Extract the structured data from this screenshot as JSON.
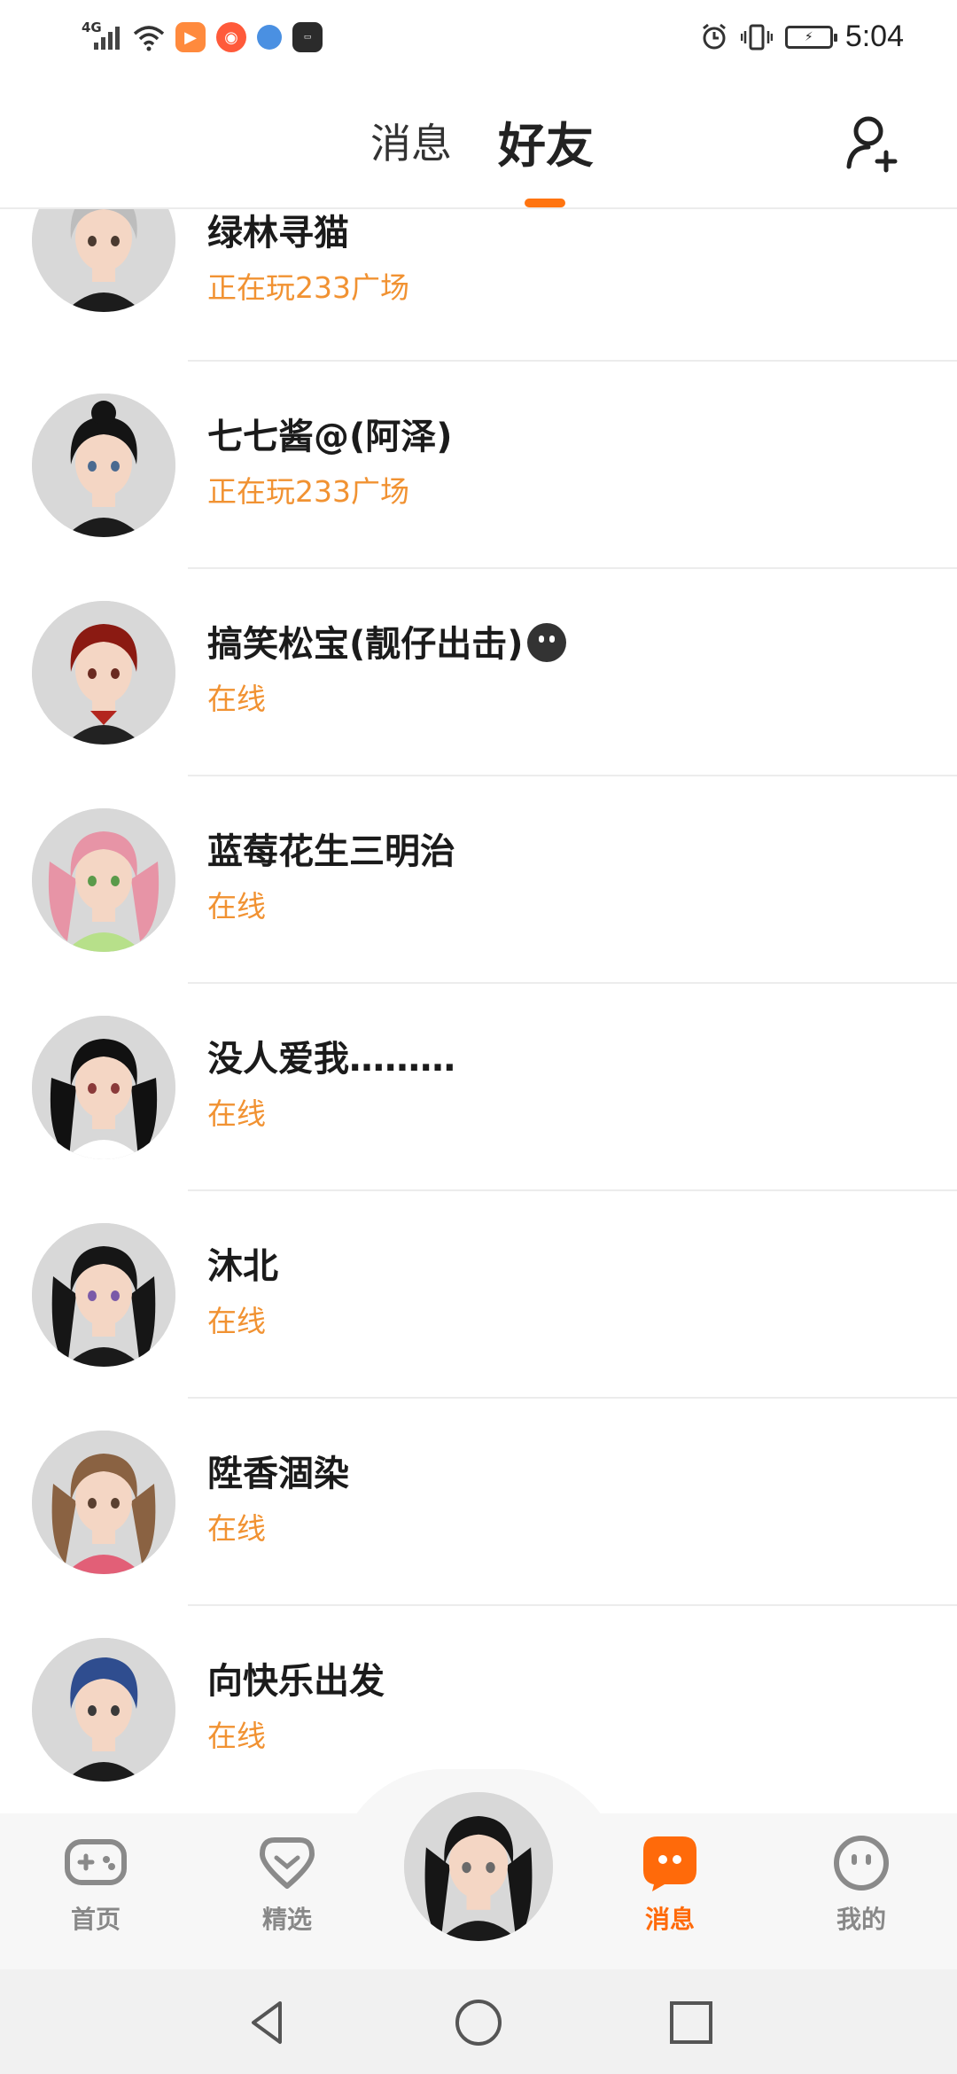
{
  "status_bar": {
    "network": "4G",
    "time": "5:04",
    "apps": [
      {
        "icon": "video-app-icon",
        "color": "#ff8a3d"
      },
      {
        "icon": "camera-app-icon",
        "color": "#ff5a3a"
      },
      {
        "icon": "browser-app-icon",
        "color": "#4a90e2"
      },
      {
        "icon": "huawei-store-icon",
        "color": "#2b2b2b"
      }
    ]
  },
  "header": {
    "tabs": [
      {
        "label": "消息",
        "active": false
      },
      {
        "label": "好友",
        "active": true
      }
    ],
    "accent": "#ff7410"
  },
  "friends": [
    {
      "name": "绿林寻猫",
      "status": "正在玩233广场",
      "hair": "#bdbdbd",
      "outfit": "#1c1c1c"
    },
    {
      "name": "七七酱@(阿泽)",
      "status": "正在玩233广场",
      "hair": "#141414",
      "outfit": "#1c1c1c"
    },
    {
      "name": "搞笑松宝(靓仔出击)",
      "status": "在线",
      "hair": "#8b1a12",
      "outfit": "#222222",
      "emoji": true
    },
    {
      "name": "蓝莓花生三明治",
      "status": "在线",
      "hair": "#e794a6",
      "outfit": "#b7e08a"
    },
    {
      "name": "没人爱我………",
      "status": "在线",
      "hair": "#111111",
      "outfit": "#ffffff"
    },
    {
      "name": "沐北",
      "status": "在线",
      "hair": "#161616",
      "outfit": "#1a1a1a"
    },
    {
      "name": "陞香涸染",
      "status": "在线",
      "hair": "#8a6242",
      "outfit": "#e25f77"
    },
    {
      "name": "向快乐出发",
      "status": "在线",
      "hair": "#2f4d8f",
      "outfit": "#1c1c1c"
    }
  ],
  "bottom_nav": {
    "items": [
      {
        "label": "首页",
        "icon": "gamepad-icon",
        "active": false
      },
      {
        "label": "精选",
        "icon": "heart-box-icon",
        "active": false
      },
      {
        "label": "消息",
        "icon": "chat-bubble-icon",
        "active": true
      },
      {
        "label": "我的",
        "icon": "smiley-face-icon",
        "active": false
      }
    ],
    "active_color": "#ff6a0a",
    "inactive_color": "#888888"
  },
  "system_nav": [
    "back-icon",
    "home-icon",
    "recents-icon"
  ]
}
